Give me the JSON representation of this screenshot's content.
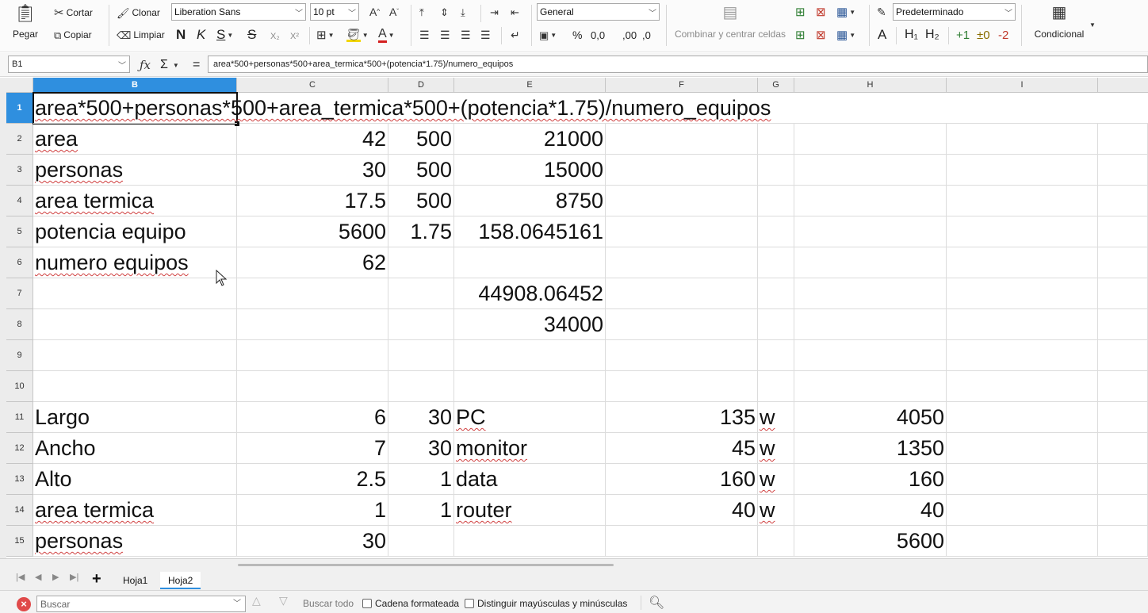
{
  "toolbar": {
    "paste_label": "Pegar",
    "cut_label": "Cortar",
    "copy_label": "Copiar",
    "clone_label": "Clonar",
    "clear_label": "Limpiar",
    "font_name": "Liberation Sans",
    "font_size": "10 pt",
    "bold_label": "N",
    "italic_label": "K",
    "underline_label": "S",
    "strike_label": "S",
    "subscript_label": "X₂",
    "superscript_label": "X²",
    "number_format": "General",
    "percent_label": "%",
    "decimal_label": "0,0",
    "add_decimal_label": ",00",
    "remove_decimal_label": ",0",
    "merge_label": "Combinar y centrar celdas",
    "style_name": "Predeterminado",
    "style_a_label": "A",
    "heading1_label": "H₁",
    "heading2_label": "H₂",
    "plus_one_label": "+1",
    "plus_minus_label": "±0",
    "minus_two_label": "-2",
    "conditional_label": "Condicional"
  },
  "formula_bar": {
    "cell_ref": "B1",
    "sum_label": "Σ",
    "equals_label": "=",
    "formula": "area*500+personas*500+area_termica*500+(potencia*1.75)/numero_equipos"
  },
  "columns": [
    {
      "id": "B",
      "label": "B",
      "active": true
    },
    {
      "id": "C",
      "label": "C",
      "active": false
    },
    {
      "id": "D",
      "label": "D",
      "active": false
    },
    {
      "id": "E",
      "label": "E",
      "active": false
    },
    {
      "id": "F",
      "label": "F",
      "active": false
    },
    {
      "id": "G",
      "label": "G",
      "active": false
    },
    {
      "id": "H",
      "label": "H",
      "active": false
    },
    {
      "id": "I",
      "label": "I",
      "active": false
    }
  ],
  "rows": [
    {
      "label": "1",
      "cells": {
        "B": "area*500+personas*500+area_termica*500+(potencia*1.75)/numero_equipos"
      }
    },
    {
      "label": "2",
      "cells": {
        "B": "area",
        "C": "42",
        "D": "500",
        "E": "21000"
      }
    },
    {
      "label": "3",
      "cells": {
        "B": "personas",
        "C": "30",
        "D": "500",
        "E": "15000"
      }
    },
    {
      "label": "4",
      "cells": {
        "B": "area termica",
        "C": "17.5",
        "D": "500",
        "E": "8750"
      }
    },
    {
      "label": "5",
      "cells": {
        "B": "potencia equipo",
        "C": "5600",
        "D": "1.75",
        "E": "158.0645161"
      }
    },
    {
      "label": "6",
      "cells": {
        "B": "numero equipos",
        "C": "62"
      }
    },
    {
      "label": "7",
      "cells": {
        "E": "44908.06452"
      }
    },
    {
      "label": "8",
      "cells": {
        "E": "34000"
      }
    },
    {
      "label": "9",
      "cells": {}
    },
    {
      "label": "10",
      "cells": {}
    },
    {
      "label": "11",
      "cells": {
        "B": "Largo",
        "C": "6",
        "D": "30",
        "E": "PC",
        "F": "135",
        "G": "w",
        "H": "4050"
      }
    },
    {
      "label": "12",
      "cells": {
        "B": "Ancho",
        "C": "7",
        "D": "30",
        "E": "monitor",
        "F": "45",
        "G": "w",
        "H": "1350"
      }
    },
    {
      "label": "13",
      "cells": {
        "B": "Alto",
        "C": "2.5",
        "D": "1",
        "E": "data",
        "F": "160",
        "G": "w",
        "H": "160"
      }
    },
    {
      "label": "14",
      "cells": {
        "B": "area termica",
        "C": "1",
        "D": "1",
        "E": "router",
        "F": "40",
        "G": "w",
        "H": "40"
      }
    },
    {
      "label": "15",
      "cells": {
        "B": "personas",
        "C": "30",
        "H": "5600"
      }
    }
  ],
  "sheet_tabs": [
    {
      "label": "Hoja1",
      "active": false
    },
    {
      "label": "Hoja2",
      "active": true
    }
  ],
  "find_bar": {
    "placeholder": "Buscar",
    "find_all_label": "Buscar todo",
    "formatted_label": "Cadena formateada",
    "match_case_label": "Distinguir mayúsculas y minúsculas"
  },
  "colors": {
    "selection_accent": "#2f8fdf",
    "spell_underline": "#d04040"
  }
}
